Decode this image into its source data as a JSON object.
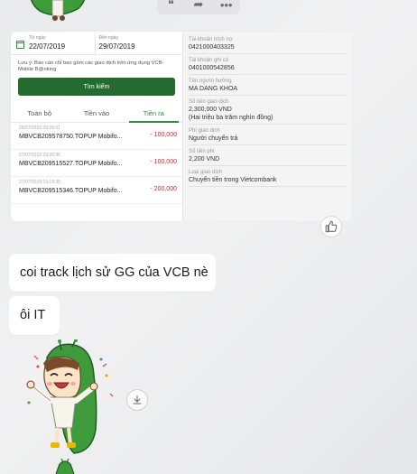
{
  "message_actions": [
    {
      "name": "quote-icon",
      "glyph": "❝"
    },
    {
      "name": "forward-icon",
      "glyph": "➦"
    },
    {
      "name": "more-icon",
      "glyph": "•••"
    }
  ],
  "bank_screenshot": {
    "from_date": {
      "label": "Từ ngày",
      "value": "22/07/2019"
    },
    "to_date": {
      "label": "Đến ngày",
      "value": "29/07/2019"
    },
    "note": "Lưu ý: Báo cáo chỉ bao gồm các giao dịch trên ứng dụng VCB-Mobile B@nking",
    "search_label": "Tìm kiếm",
    "tabs": [
      "Toàn bộ",
      "Tiền vào",
      "Tiền ra"
    ],
    "active_tab": "Tiền ra",
    "transactions": [
      {
        "time": "29/07/2019 20:29:01",
        "desc": "MBVCB209578750.TOPUP Mobifo...",
        "amount": "- 100,000"
      },
      {
        "time": "27/07/2019 23:20:36",
        "desc": "MBVCB209515527.TOPUP Mobifo...",
        "amount": "- 100,000"
      },
      {
        "time": "27/07/2019 23:19:35",
        "desc": "MBVCB209515346.TOPUP Mobifo...",
        "amount": "- 200,000"
      }
    ],
    "details": [
      {
        "label": "Tài khoản trích nợ",
        "value": "0421000403325"
      },
      {
        "label": "Tài khoản ghi có",
        "value": "0401000542856"
      },
      {
        "label": "Tên người hưởng",
        "value": "MA DANG KHOA"
      },
      {
        "label": "Số tiền giao dịch",
        "value": "2,300,000 VND",
        "extra": "(Hai triệu ba trăm nghìn đồng)"
      },
      {
        "label": "Phí giao dịch",
        "value": "Người chuyển trả"
      },
      {
        "label": "Số tiền phí",
        "value": "2,200 VND"
      },
      {
        "label": "Loại giao dịch",
        "value": "Chuyển tiền trong Vietcombank"
      }
    ],
    "colors": {
      "brand": "#236b2f",
      "accent": "#2e8b3e",
      "debit": "#d8262e"
    }
  },
  "messages": [
    {
      "text": "coi track lịch sử GG của VCB nè"
    },
    {
      "text": "ôi IT"
    }
  ],
  "icons": {
    "like": "thumbs-up-icon",
    "download": "download-icon"
  }
}
